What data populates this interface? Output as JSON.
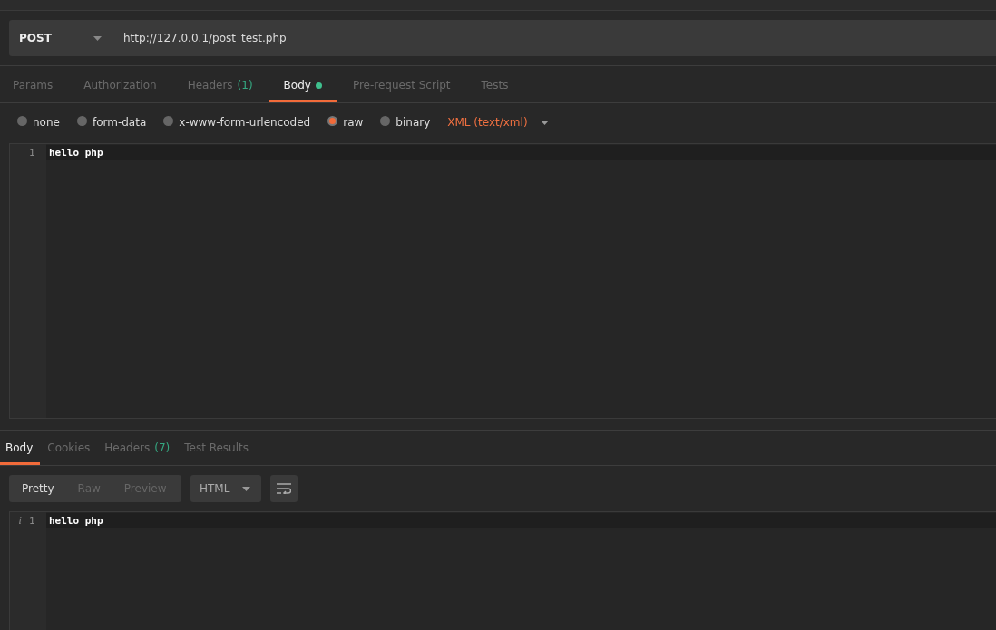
{
  "request": {
    "method": "POST",
    "url": "http://127.0.0.1/post_test.php"
  },
  "request_tabs": [
    {
      "label": "Params",
      "selected": false
    },
    {
      "label": "Authorization",
      "selected": false
    },
    {
      "label": "Headers",
      "count": "(1)",
      "selected": false
    },
    {
      "label": "Body",
      "dot": true,
      "selected": true
    },
    {
      "label": "Pre-request Script",
      "selected": false
    },
    {
      "label": "Tests",
      "selected": false
    }
  ],
  "body_modes": [
    {
      "label": "none",
      "selected": false
    },
    {
      "label": "form-data",
      "selected": false
    },
    {
      "label": "x-www-form-urlencoded",
      "selected": false
    },
    {
      "label": "raw",
      "selected": true
    },
    {
      "label": "binary",
      "selected": false
    }
  ],
  "content_type": "XML (text/xml)",
  "request_editor": {
    "lines": [
      {
        "number": "1",
        "text": "hello php"
      }
    ]
  },
  "response_tabs": [
    {
      "label": "Body",
      "selected": true
    },
    {
      "label": "Cookies",
      "selected": false
    },
    {
      "label": "Headers",
      "count": "(7)",
      "selected": false
    },
    {
      "label": "Test Results",
      "selected": false
    }
  ],
  "view_modes": [
    {
      "label": "Pretty",
      "selected": true
    },
    {
      "label": "Raw",
      "selected": false
    },
    {
      "label": "Preview",
      "selected": false
    }
  ],
  "format": "HTML",
  "response_editor": {
    "lines": [
      {
        "marker": "i",
        "number": "1",
        "text": "hello php"
      }
    ]
  }
}
